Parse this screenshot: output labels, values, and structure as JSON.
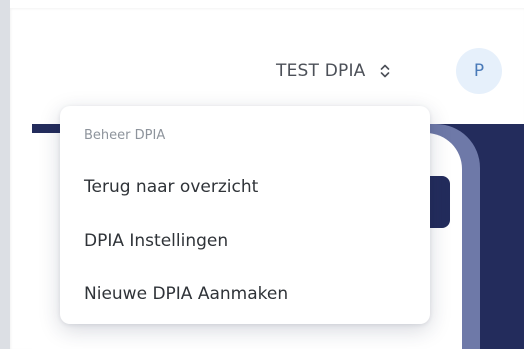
{
  "header": {
    "project_name": "TEST DPIA",
    "switch_icon": "chevron-up-down-icon",
    "avatar_initial": "P"
  },
  "dropdown": {
    "section_title": "Beheer DPIA",
    "items": [
      {
        "label": "Terug naar overzicht"
      },
      {
        "label": "DPIA Instellingen"
      },
      {
        "label": "Nieuwe DPIA Aanmaken"
      }
    ]
  },
  "colors": {
    "navy": "#232c5c",
    "lavender": "#6e79a8",
    "avatar_bg": "#e6f0fb",
    "avatar_text": "#4a7ab8"
  }
}
